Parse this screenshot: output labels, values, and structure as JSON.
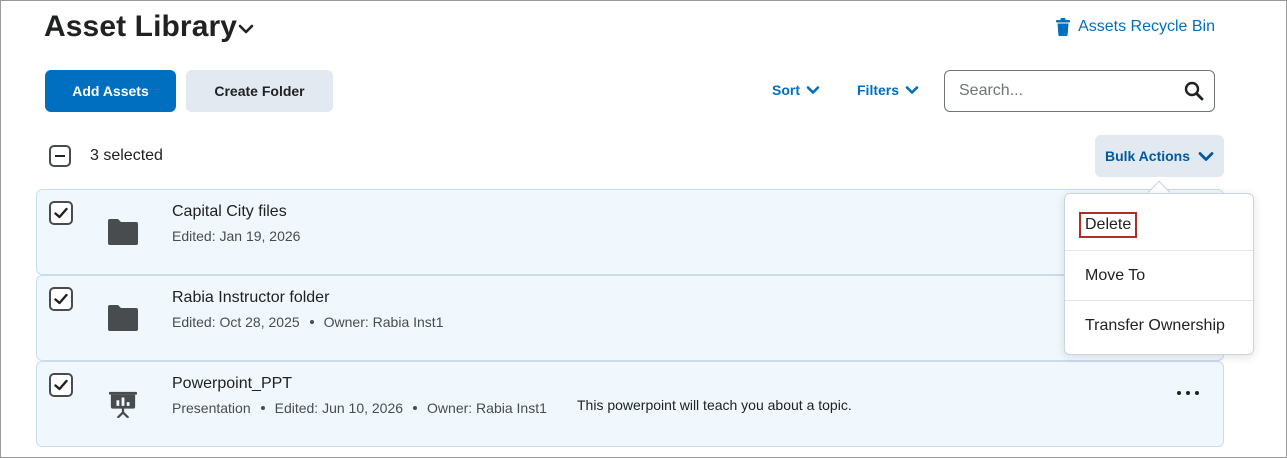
{
  "header": {
    "title": "Asset Library",
    "recycle_bin_label": "Assets Recycle Bin"
  },
  "toolbar": {
    "add_assets_label": "Add Assets",
    "create_folder_label": "Create Folder",
    "sort_label": "Sort",
    "filters_label": "Filters",
    "search_placeholder": "Search..."
  },
  "selection": {
    "selected_text": "3 selected",
    "bulk_actions_label": "Bulk Actions"
  },
  "bulk_menu": {
    "items": [
      {
        "label": "Delete"
      },
      {
        "label": "Move To"
      },
      {
        "label": "Transfer Ownership"
      }
    ]
  },
  "assets": [
    {
      "name": "Capital City files",
      "edited": "Edited: Jan 19, 2026",
      "icon": "folder-icon"
    },
    {
      "name": "Rabia Instructor folder",
      "edited": "Edited: Oct 28, 2025",
      "owner": "Owner: Rabia Inst1",
      "icon": "folder-icon"
    },
    {
      "name": "Powerpoint_PPT",
      "type": "Presentation",
      "edited": "Edited: Jun 10, 2026",
      "owner": "Owner: Rabia Inst1",
      "description": "This powerpoint will teach you about a topic.",
      "icon": "presentation-icon"
    }
  ],
  "colors": {
    "primary": "#006fbf",
    "secondary_bg": "#e3e9f1",
    "row_bg": "#f1f8fd",
    "highlight_outline": "#b22b2b"
  }
}
